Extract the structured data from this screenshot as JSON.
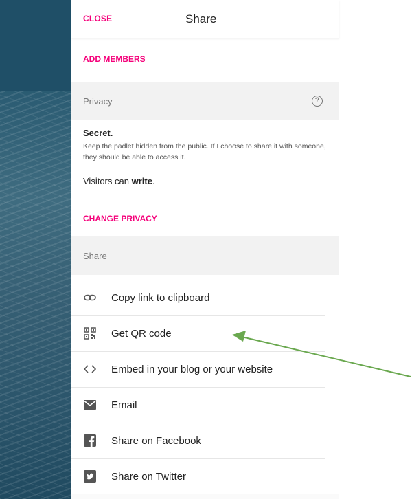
{
  "header": {
    "close_label": "CLOSE",
    "title": "Share"
  },
  "add_members_label": "ADD MEMBERS",
  "privacy": {
    "section_label": "Privacy",
    "help_glyph": "?",
    "secret_title": "Secret.",
    "secret_desc": "Keep the padlet hidden from the public. If I choose to share it with someone, they should be able to access it.",
    "visitors_prefix": "Visitors can ",
    "visitors_perm": "write",
    "visitors_suffix": ".",
    "change_label": "CHANGE PRIVACY"
  },
  "share": {
    "section_label": "Share",
    "items": [
      {
        "label": "Copy link to clipboard",
        "icon": "link-icon"
      },
      {
        "label": "Get QR code",
        "icon": "qr-code-icon"
      },
      {
        "label": "Embed in your blog or your website",
        "icon": "code-icon"
      },
      {
        "label": "Email",
        "icon": "email-icon"
      },
      {
        "label": "Share on Facebook",
        "icon": "facebook-icon"
      },
      {
        "label": "Share on Twitter",
        "icon": "twitter-icon"
      }
    ]
  },
  "colors": {
    "accent": "#f5007a",
    "annotation_arrow": "#6aa84f",
    "background_strip": "#2a5b72"
  }
}
